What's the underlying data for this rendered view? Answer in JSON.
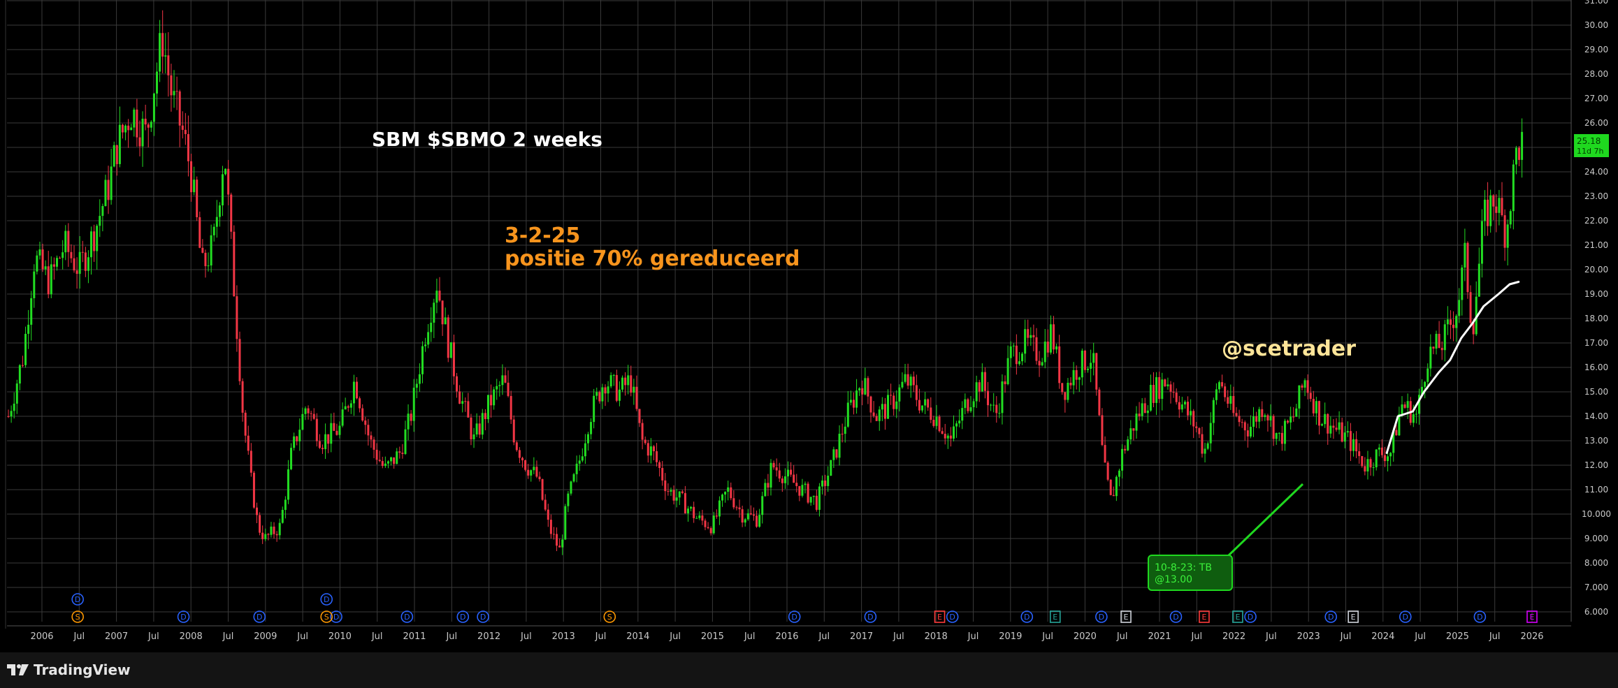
{
  "title": "SBM $SBMO 2 weeks",
  "annotation": {
    "line1": "3-2-25",
    "line2": "positie 70% gereduceerd"
  },
  "watermark": "@scetrader",
  "callout": {
    "line1": "10-8-23: TB",
    "line2": "@13.00"
  },
  "price_badge": {
    "price": "25.18",
    "countdown": "11d 7h"
  },
  "footer": {
    "brand": "TradingView"
  },
  "colors": {
    "background": "#000000",
    "grid": "#3a3a3a",
    "up": "#22dd22",
    "down": "#f23645",
    "title": "#ffffff",
    "annotation": "#f7941d",
    "watermark": "#ffe599",
    "ma_line": "#ffffff",
    "callout": "#1fd81f",
    "dividend": "#2962ff",
    "split": "#ff9800",
    "earnings": "#ff3b3b",
    "earnings_alt": "#26a69a",
    "earnings_gray": "#d1d4dc",
    "earnings_purple": "#d500f9"
  },
  "chart_data": {
    "type": "candlestick",
    "interval": "2 weeks",
    "x_ticks": [
      "2006",
      "Jul",
      "2007",
      "Jul",
      "2008",
      "Jul",
      "2009",
      "Jul",
      "2010",
      "Jul",
      "2011",
      "Jul",
      "2012",
      "Jul",
      "2013",
      "Jul",
      "2014",
      "Jul",
      "2015",
      "Jul",
      "2016",
      "Jul",
      "2017",
      "Jul",
      "2018",
      "Jul",
      "2019",
      "Jul",
      "2020",
      "Jul",
      "2021",
      "Jul",
      "2022",
      "Jul",
      "2023",
      "Jul",
      "2024",
      "Jul",
      "2025",
      "Jul",
      "2026"
    ],
    "y_ticks": [
      "6.000",
      "7.000",
      "8.000",
      "9.000",
      "10.000",
      "11.00",
      "12.00",
      "13.00",
      "14.00",
      "15.00",
      "16.00",
      "17.00",
      "18.00",
      "19.00",
      "20.00",
      "21.00",
      "22.00",
      "23.00",
      "24.00",
      "25.00",
      "26.00",
      "27.00",
      "28.00",
      "29.00",
      "30.00",
      "31.00"
    ],
    "ylim": [
      6,
      31
    ],
    "last_price": 25.18,
    "price_path": [
      [
        2005.55,
        14.0
      ],
      [
        2005.75,
        16.5
      ],
      [
        2005.9,
        20.5
      ],
      [
        2006.1,
        19.5
      ],
      [
        2006.3,
        21.0
      ],
      [
        2006.5,
        20.0
      ],
      [
        2006.7,
        21.5
      ],
      [
        2006.9,
        23.5
      ],
      [
        2007.0,
        25.0
      ],
      [
        2007.2,
        26.5
      ],
      [
        2007.4,
        25.5
      ],
      [
        2007.5,
        27.5
      ],
      [
        2007.62,
        29.5
      ],
      [
        2007.75,
        27.0
      ],
      [
        2007.9,
        25.5
      ],
      [
        2008.0,
        24.0
      ],
      [
        2008.15,
        20.0
      ],
      [
        2008.3,
        21.0
      ],
      [
        2008.45,
        25.0
      ],
      [
        2008.55,
        20.5
      ],
      [
        2008.7,
        14.0
      ],
      [
        2008.8,
        11.5
      ],
      [
        2008.9,
        9.5
      ],
      [
        2009.0,
        9.0
      ],
      [
        2009.2,
        9.5
      ],
      [
        2009.35,
        12.5
      ],
      [
        2009.55,
        14.5
      ],
      [
        2009.75,
        13.0
      ],
      [
        2010.0,
        13.5
      ],
      [
        2010.2,
        15.5
      ],
      [
        2010.4,
        13.0
      ],
      [
        2010.6,
        11.8
      ],
      [
        2010.8,
        12.5
      ],
      [
        2010.95,
        14.0
      ],
      [
        2011.15,
        17.5
      ],
      [
        2011.3,
        19.5
      ],
      [
        2011.45,
        17.0
      ],
      [
        2011.6,
        15.0
      ],
      [
        2011.8,
        13.0
      ],
      [
        2012.0,
        14.5
      ],
      [
        2012.2,
        15.5
      ],
      [
        2012.35,
        13.0
      ],
      [
        2012.5,
        12.0
      ],
      [
        2012.65,
        11.5
      ],
      [
        2012.8,
        9.5
      ],
      [
        2012.95,
        8.5
      ],
      [
        2013.05,
        10.5
      ],
      [
        2013.2,
        12.0
      ],
      [
        2013.35,
        14.0
      ],
      [
        2013.55,
        15.5
      ],
      [
        2013.75,
        15.0
      ],
      [
        2013.9,
        15.5
      ],
      [
        2014.05,
        13.0
      ],
      [
        2014.2,
        12.5
      ],
      [
        2014.4,
        11.0
      ],
      [
        2014.6,
        10.5
      ],
      [
        2014.8,
        9.8
      ],
      [
        2015.0,
        9.5
      ],
      [
        2015.2,
        11.0
      ],
      [
        2015.4,
        10.0
      ],
      [
        2015.6,
        9.8
      ],
      [
        2015.8,
        12.0
      ],
      [
        2016.0,
        11.5
      ],
      [
        2016.2,
        11.0
      ],
      [
        2016.4,
        10.5
      ],
      [
        2016.6,
        12.0
      ],
      [
        2016.8,
        14.0
      ],
      [
        2017.0,
        15.5
      ],
      [
        2017.2,
        14.0
      ],
      [
        2017.4,
        14.5
      ],
      [
        2017.6,
        15.5
      ],
      [
        2017.8,
        14.5
      ],
      [
        2018.0,
        14.0
      ],
      [
        2018.2,
        13.0
      ],
      [
        2018.4,
        14.5
      ],
      [
        2018.6,
        15.5
      ],
      [
        2018.8,
        14.0
      ],
      [
        2019.0,
        16.5
      ],
      [
        2019.2,
        17.0
      ],
      [
        2019.4,
        16.5
      ],
      [
        2019.55,
        17.5
      ],
      [
        2019.7,
        15.0
      ],
      [
        2019.9,
        16.0
      ],
      [
        2020.1,
        16.5
      ],
      [
        2020.25,
        12.0
      ],
      [
        2020.35,
        10.5
      ],
      [
        2020.5,
        12.5
      ],
      [
        2020.7,
        14.0
      ],
      [
        2020.9,
        15.0
      ],
      [
        2021.1,
        15.5
      ],
      [
        2021.3,
        14.5
      ],
      [
        2021.5,
        13.5
      ],
      [
        2021.6,
        12.5
      ],
      [
        2021.8,
        15.5
      ],
      [
        2022.0,
        14.0
      ],
      [
        2022.2,
        13.5
      ],
      [
        2022.4,
        14.5
      ],
      [
        2022.6,
        13.0
      ],
      [
        2022.8,
        14.0
      ],
      [
        2022.95,
        15.5
      ],
      [
        2023.15,
        14.0
      ],
      [
        2023.35,
        13.5
      ],
      [
        2023.55,
        13.0
      ],
      [
        2023.75,
        12.0
      ],
      [
        2023.95,
        12.5
      ],
      [
        2024.1,
        12.5
      ],
      [
        2024.25,
        14.5
      ],
      [
        2024.45,
        14.0
      ],
      [
        2024.6,
        16.5
      ],
      [
        2024.8,
        17.0
      ],
      [
        2025.0,
        18.5
      ],
      [
        2025.1,
        20.5
      ],
      [
        2025.2,
        17.5
      ],
      [
        2025.35,
        22.0
      ],
      [
        2025.5,
        23.0
      ],
      [
        2025.65,
        21.5
      ],
      [
        2025.8,
        25.0
      ],
      [
        2025.9,
        25.18
      ]
    ],
    "moving_average": [
      [
        2024.05,
        12.5
      ],
      [
        2024.2,
        14.0
      ],
      [
        2024.4,
        14.2
      ],
      [
        2024.55,
        15.0
      ],
      [
        2024.75,
        15.8
      ],
      [
        2024.9,
        16.3
      ],
      [
        2025.05,
        17.2
      ],
      [
        2025.2,
        17.8
      ],
      [
        2025.35,
        18.5
      ],
      [
        2025.55,
        19.0
      ],
      [
        2025.7,
        19.4
      ],
      [
        2025.82,
        19.5
      ]
    ],
    "event_markers": {
      "dividends": [
        2007.9,
        2008.92,
        2009.95,
        2010.9,
        2011.92,
        2011.65,
        2016.1,
        2017.12,
        2018.22,
        2019.22,
        2020.22,
        2021.22,
        2022.22,
        2023.3,
        2024.3,
        2025.3
      ],
      "splits": [
        2006.48,
        2009.82,
        2013.62
      ],
      "earnings": [
        2018.05,
        2019.6,
        2020.55,
        2021.6,
        2022.05,
        2023.6,
        2026.0
      ]
    }
  }
}
